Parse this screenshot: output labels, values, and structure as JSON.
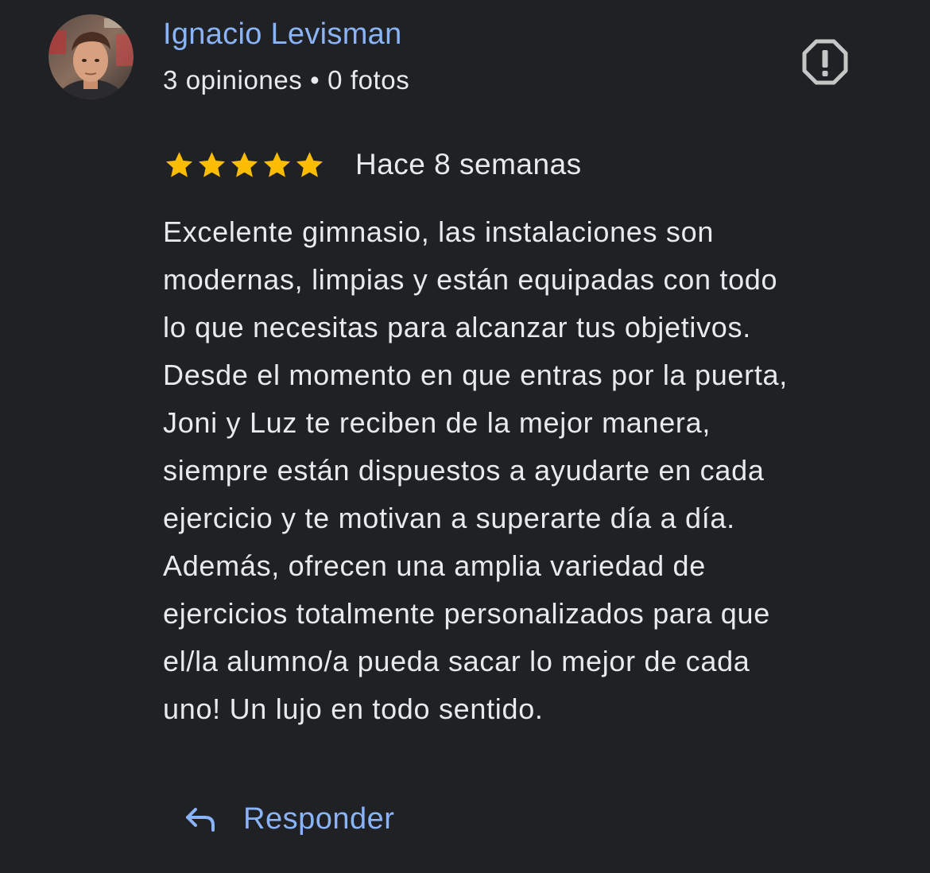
{
  "reviewer": {
    "name": "Ignacio Levisman",
    "meta": "3 opiniones • 0 fotos"
  },
  "review": {
    "rating": 5,
    "max_rating": 5,
    "date": "Hace 8 semanas",
    "text": "Excelente gimnasio, las instalaciones son\nmodernas, limpias y están equipadas con todo\nlo que necesitas para alcanzar tus objetivos.\nDesde el momento en que entras por la puerta,\nJoni y Luz te reciben de la mejor manera,\nsiempre están dispuestos a ayudarte en cada\nejercicio y te motivan a superarte día a día.\nAdemás, ofrecen una amplia variedad de\nejercicios totalmente personalizados para que\nel/la alumno/a pueda sacar lo mejor de cada\nuno! Un lujo en todo sentido."
  },
  "actions": {
    "reply_label": "Responder",
    "reply_icon": "reply-arrow-icon",
    "report_icon": "report-flag-icon"
  },
  "colors": {
    "background": "#202124",
    "text": "#e8eaed",
    "link": "#8ab4f8",
    "star": "#fbbc04",
    "icon_gray": "#c4c7c5"
  }
}
